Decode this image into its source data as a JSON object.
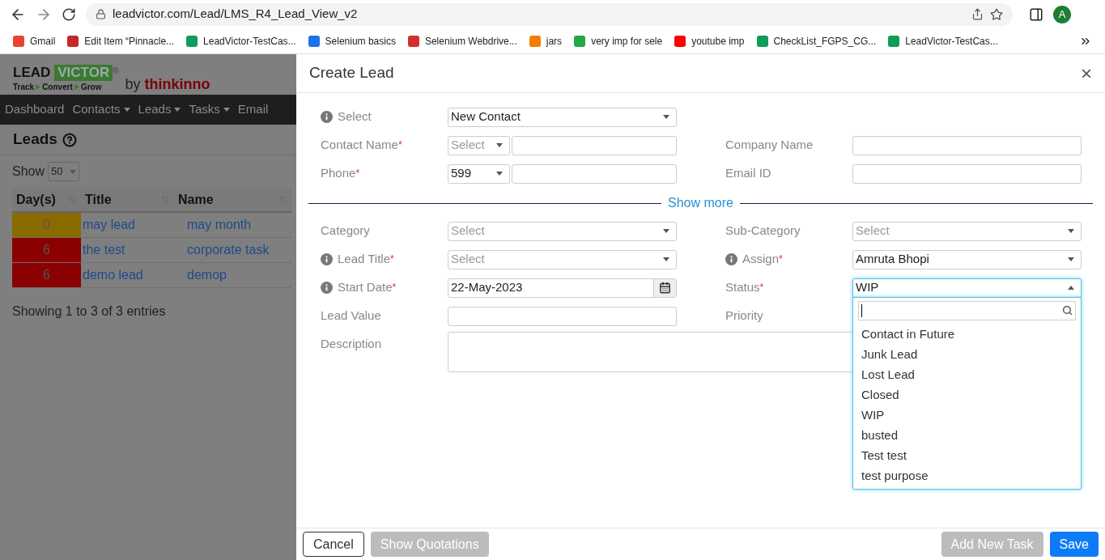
{
  "browser": {
    "url": "leadvictor.com/Lead/LMS_R4_Lead_View_v2",
    "profile": "A",
    "bookmarks": [
      {
        "label": "Gmail",
        "color": "#ea4335"
      },
      {
        "label": "Edit Item “Pinnacle...",
        "color": "#c62828"
      },
      {
        "label": "LeadVictor-TestCas...",
        "color": "#0f9d58"
      },
      {
        "label": "Selenium basics",
        "color": "#1a73e8"
      },
      {
        "label": "Selenium Webdrive...",
        "color": "#d32f2f"
      },
      {
        "label": "jars",
        "color": "#f57c00"
      },
      {
        "label": "very imp for sele",
        "color": "#22a845"
      },
      {
        "label": "youtube imp",
        "color": "#ff0000"
      },
      {
        "label": "CheckList_FGPS_CG...",
        "color": "#0f9d58"
      },
      {
        "label": "LeadVictor-TestCas...",
        "color": "#0f9d58"
      }
    ]
  },
  "page": {
    "logo": {
      "lead": "LEAD",
      "victor": "VICTOR",
      "reg": "®",
      "steps": [
        "Track",
        "Convert",
        "Grow"
      ],
      "by": "by",
      "brand": "thinkinno"
    },
    "nav": [
      {
        "label": "Dashboard",
        "caret": false
      },
      {
        "label": "Contacts",
        "caret": true
      },
      {
        "label": "Leads",
        "caret": true
      },
      {
        "label": "Tasks",
        "caret": true
      },
      {
        "label": "Email",
        "caret": false
      }
    ],
    "heading": "Leads",
    "show_label": "Show",
    "page_size": "50",
    "table": {
      "columns": [
        "Day(s)",
        "Title",
        "Name"
      ],
      "rows": [
        {
          "days": "0",
          "color": "#8a6b00",
          "title": "may lead",
          "name": "may month"
        },
        {
          "days": "6",
          "color": "#8b0000",
          "title": "the test",
          "name": "corporate task"
        },
        {
          "days": "6",
          "color": "#8b0000",
          "title": "demo lead",
          "name": "demop"
        }
      ]
    },
    "info": "Showing 1 to 3 of 3 entries"
  },
  "modal": {
    "title": "Create Lead",
    "close": "×",
    "top_rows": [
      [
        {
          "label": "Select",
          "info": true,
          "required": false,
          "kind": "select",
          "value": "New Contact"
        },
        null
      ],
      [
        {
          "label": "Contact Name",
          "info": false,
          "required": true,
          "kind": "split",
          "prefix_placeholder": "Select"
        },
        {
          "label": "Company Name",
          "info": false,
          "required": false,
          "kind": "input"
        }
      ],
      [
        {
          "label": "Phone",
          "info": false,
          "required": true,
          "kind": "split",
          "prefix_value": "599"
        },
        {
          "label": "Email ID",
          "info": false,
          "required": false,
          "kind": "input"
        }
      ]
    ],
    "show_more": "Show more",
    "rows": [
      [
        {
          "label": "Category",
          "info": false,
          "required": false,
          "kind": "select",
          "placeholder": "Select"
        },
        {
          "label": "Sub-Category",
          "info": false,
          "required": false,
          "kind": "select",
          "placeholder": "Select"
        }
      ],
      [
        {
          "label": "Lead Title",
          "info": true,
          "required": true,
          "kind": "select",
          "placeholder": "Select"
        },
        {
          "label": "Assign",
          "info": true,
          "required": true,
          "kind": "select",
          "value": "Amruta Bhopi"
        }
      ],
      [
        {
          "label": "Start Date",
          "info": true,
          "required": true,
          "kind": "date",
          "value": "22-May-2023"
        },
        {
          "label": "Status",
          "info": false,
          "required": true,
          "kind": "select",
          "value": "WIP",
          "expanded": true
        }
      ],
      [
        {
          "label": "Lead Value",
          "info": false,
          "required": false,
          "kind": "input"
        },
        {
          "label": "Priority",
          "info": false,
          "required": false,
          "kind": "label"
        }
      ]
    ],
    "description": {
      "label": "Description"
    },
    "required_mark": "*",
    "dropdown_options": [
      "Contact in Future",
      "Junk Lead",
      "Lost Lead",
      "Closed",
      "WIP",
      "busted",
      "Test test",
      "test purpose"
    ],
    "buttons": [
      {
        "label": "Cancel",
        "kind": "outline"
      },
      {
        "label": "Show Quotations",
        "kind": "muted"
      },
      {
        "label": "Add New Task",
        "kind": "muted"
      },
      {
        "label": "Save",
        "kind": "primary"
      }
    ]
  }
}
